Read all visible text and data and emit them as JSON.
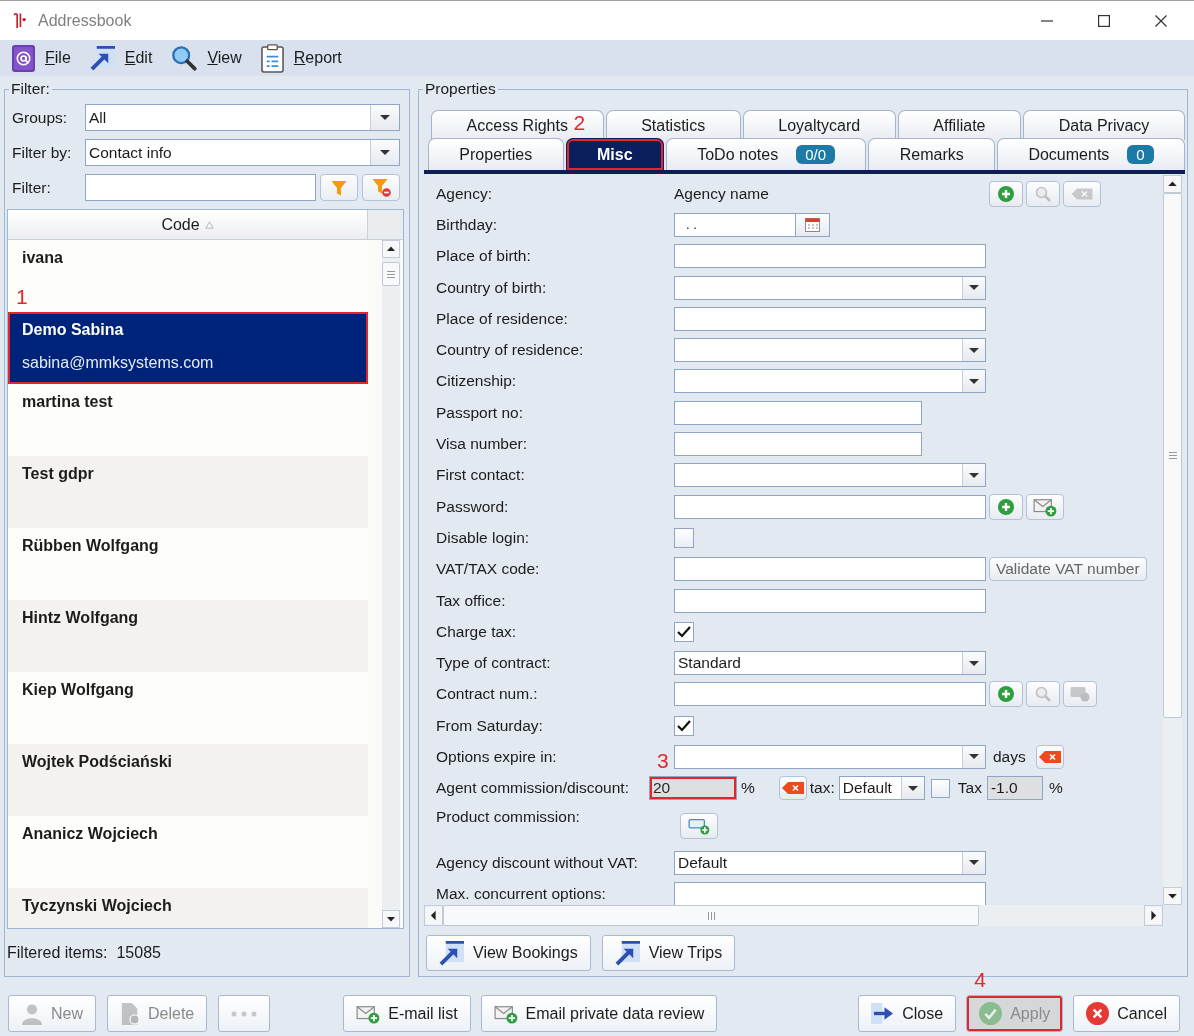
{
  "window": {
    "title": "Addressbook"
  },
  "menu": [
    {
      "label": "File",
      "kind": "file"
    },
    {
      "label": "Edit",
      "kind": "edit"
    },
    {
      "label": "View",
      "kind": "view"
    },
    {
      "label": "Report",
      "kind": "report"
    }
  ],
  "filter": {
    "legend": "Filter:",
    "groups": {
      "label": "Groups:",
      "value": "All"
    },
    "filter_by": {
      "label": "Filter by:",
      "value": "Contact info"
    },
    "filter_text": {
      "label": "Filter:"
    }
  },
  "contacts": {
    "column": "Code",
    "rows": [
      {
        "name": "ivana",
        "selected": false
      },
      {
        "name": "Demo Sabina",
        "email": "sabina@mmksystems.com",
        "selected": true,
        "callout": "1"
      },
      {
        "name": "martina test",
        "selected": false
      },
      {
        "name": "Test gdpr",
        "selected": false
      },
      {
        "name": "Rübben Wolfgang",
        "selected": false
      },
      {
        "name": "Hintz Wolfgang",
        "selected": false
      },
      {
        "name": "Kiep Wolfgang",
        "selected": false
      },
      {
        "name": "Wojtek Podściański",
        "selected": false
      },
      {
        "name": "Ananicz Wojciech",
        "selected": false
      },
      {
        "name": "Tyczynski Wojciech",
        "selected": false
      }
    ]
  },
  "filtered_items": {
    "label": "Filtered items:",
    "count": "15085"
  },
  "properties": {
    "legend": "Properties",
    "tab_rows": [
      {
        "tabs": [
          {
            "label": "Access Rights",
            "selected": false
          },
          {
            "label": "Statistics",
            "selected": false
          },
          {
            "label": "Loyaltycard",
            "selected": false
          },
          {
            "label": "Affiliate",
            "selected": false
          },
          {
            "label": "Data Privacy",
            "selected": false
          }
        ]
      },
      {
        "tabs": [
          {
            "label": "Properties",
            "selected": false
          },
          {
            "label": "Misc",
            "selected": true,
            "callout": "2"
          },
          {
            "label": "ToDo notes",
            "badge": "0/0",
            "selected": false
          },
          {
            "label": "Remarks",
            "selected": false
          },
          {
            "label": "Documents",
            "badge": "0",
            "selected": false
          }
        ]
      }
    ],
    "fields": [
      {
        "kind": "display",
        "label": "Agency:",
        "value": "Agency name",
        "actions": [
          {
            "kind": "add",
            "disabled": false
          },
          {
            "kind": "search",
            "disabled": true
          },
          {
            "kind": "erase",
            "disabled": true
          }
        ]
      },
      {
        "kind": "date",
        "label": "Birthday:",
        "value": ". ."
      },
      {
        "kind": "text",
        "label": "Place of birth:"
      },
      {
        "kind": "combo",
        "label": "Country of birth:"
      },
      {
        "kind": "text",
        "label": "Place of residence:"
      },
      {
        "kind": "combo",
        "label": "Country of residence:"
      },
      {
        "kind": "combo",
        "label": "Citizenship:"
      },
      {
        "kind": "shorttext",
        "label": "Passport no:"
      },
      {
        "kind": "shorttext",
        "label": "Visa number:"
      },
      {
        "kind": "combo",
        "label": "First contact:"
      },
      {
        "kind": "text",
        "label": "Password:",
        "actions": [
          {
            "kind": "add",
            "disabled": false
          },
          {
            "kind": "mail",
            "disabled": false
          }
        ]
      },
      {
        "kind": "checkbox",
        "label": "Disable login:",
        "checked": false
      },
      {
        "kind": "text",
        "label": "VAT/TAX code:",
        "actions": [
          {
            "kind": "label",
            "label": "Validate VAT number",
            "disabled": true
          }
        ]
      },
      {
        "kind": "text",
        "label": "Tax office:"
      },
      {
        "kind": "checkbox",
        "label": "Charge tax:",
        "checked": true
      },
      {
        "kind": "combo",
        "label": "Type of contract:",
        "value": "Standard"
      },
      {
        "kind": "text",
        "label": "Contract num.:",
        "actions": [
          {
            "kind": "add",
            "disabled": false
          },
          {
            "kind": "search",
            "disabled": true
          },
          {
            "kind": "card",
            "disabled": true
          }
        ]
      },
      {
        "kind": "checkbox",
        "label": "From Saturday:",
        "checked": true
      },
      {
        "kind": "combo",
        "label": "Options expire in:",
        "suffix": "days",
        "actions": [
          {
            "kind": "remove",
            "disabled": false
          }
        ]
      },
      {
        "kind": "commission",
        "label": "Agent commission/discount:",
        "value": "20",
        "disabled": true,
        "callout": "3",
        "unit": "%",
        "actions": [
          {
            "kind": "remove",
            "disabled": false
          }
        ],
        "tax_label": "tax:",
        "tax_mode": "Default",
        "tax_checked": false,
        "tax_name": "Tax",
        "tax_value": "-1.0",
        "tax_disabled": true,
        "tax_unit": "%"
      },
      {
        "kind": "button",
        "label": "Product commission:",
        "actions": [
          {
            "kind": "cardadd",
            "disabled": false
          }
        ]
      },
      {
        "kind": "combo",
        "label": "Agency discount without VAT:",
        "value": "Default"
      },
      {
        "kind": "text",
        "label": "Max. concurrent options:"
      }
    ],
    "view_buttons": [
      {
        "label": "View Bookings"
      },
      {
        "label": "View Trips"
      }
    ]
  },
  "toolbar": {
    "left": [
      {
        "kind": "new",
        "label": "New",
        "disabled": true
      },
      {
        "kind": "delete",
        "label": "Delete",
        "disabled": true
      },
      {
        "kind": "more",
        "disabled": true
      }
    ],
    "middle": [
      {
        "kind": "mail",
        "label": "E-mail list",
        "disabled": false
      },
      {
        "kind": "mail",
        "label": "Email private data review",
        "disabled": false
      }
    ],
    "right": [
      {
        "kind": "close",
        "label": "Close",
        "disabled": false
      },
      {
        "kind": "apply",
        "label": "Apply",
        "disabled": true,
        "pressed": true,
        "callout": "4"
      },
      {
        "kind": "cancel",
        "label": "Cancel",
        "disabled": false
      }
    ]
  }
}
